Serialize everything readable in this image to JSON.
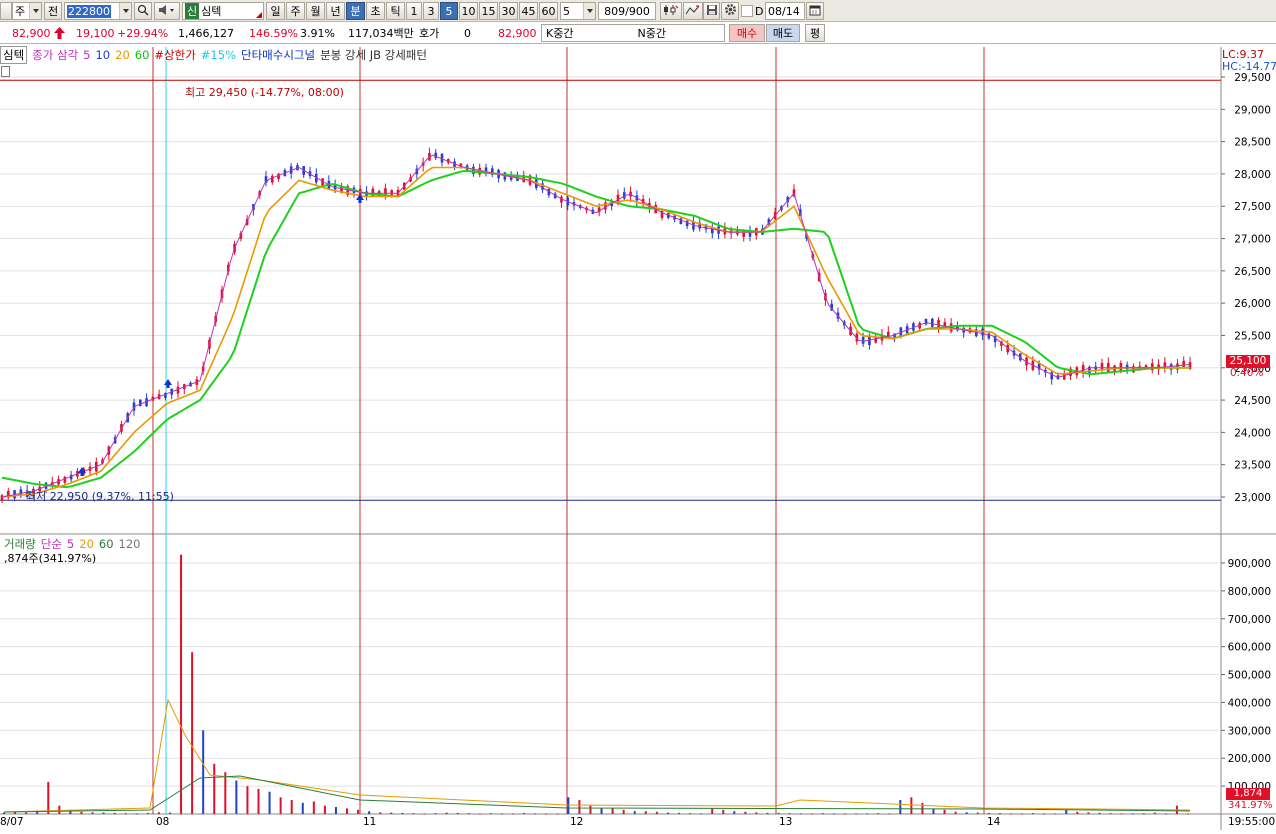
{
  "toolbar": {
    "mode_label": "주",
    "prev_label": "전",
    "code_value": "222800",
    "search_icon": "search-icon",
    "speaker_icon": "speaker-icon",
    "market_badge": "신",
    "stock_name": "심텍",
    "period_tabs": [
      "일",
      "주",
      "월",
      "년",
      "분",
      "초",
      "틱"
    ],
    "active_period": "분",
    "interval_tabs": [
      "1",
      "3",
      "5",
      "10",
      "15",
      "30",
      "45",
      "60"
    ],
    "active_interval": "5",
    "interval_select": "5",
    "count_value": "809",
    "count_total": "/900",
    "tool_icons": [
      "candle-settings-icon",
      "indicator-icon",
      "save-icon",
      "gear-icon"
    ],
    "d_checkbox_label": "D",
    "date_value": "08/14",
    "calendar_icon": "calendar-icon"
  },
  "quote": {
    "price": "82,900",
    "change": "19,100",
    "change_pct": "+29.94%",
    "volume": "1,466,127",
    "volume_ratio": "146.59%",
    "turnover_pct": "3.91%",
    "amount": "117,034백만",
    "bid_label": "호가",
    "bid_value": "0",
    "ask_value": "82,900",
    "k_label": "K중간",
    "n_label": "N중간",
    "buy_label": "매수",
    "sell_label": "매도",
    "flat_label": "평"
  },
  "legend_price": {
    "stock": "심텍",
    "ma_label": "종가 삼각",
    "ma5": "5",
    "ma10": "10",
    "ma20": "20",
    "ma60": "60",
    "upper_limit": "#상한가",
    "pct15": "#15%",
    "signal": "단타매수시그널",
    "pattern": "분봉 강세 JB 강세패턴"
  },
  "legend_volume": {
    "name": "거래량",
    "ma_label": "단순",
    "ma5": "5",
    "ma20": "20",
    "ma60": "60",
    "ma120": "120",
    "current": ",874주(341.97%)"
  },
  "annotations": {
    "high": "최고 29,450 (-14.77%, 08:00)",
    "low": "최저 22,950 (9.37%, 11:55)"
  },
  "right_panel": {
    "lc": "LC:9.37",
    "hc": "HC:-14.77",
    "price_tag": "25,100",
    "price_pct": "0.40%",
    "vol_tag": "1,874",
    "vol_pct": "341.97%",
    "time_label": "19:55:00"
  },
  "chart_data": [
    {
      "type": "line",
      "title": "",
      "x_ticks": [
        "8/07",
        "08",
        "11",
        "12",
        "13",
        "14"
      ],
      "y_ticks": [
        29500,
        29000,
        28500,
        28000,
        27500,
        27000,
        26500,
        26000,
        25500,
        25000,
        24500,
        24000,
        23500,
        23000
      ],
      "ylim": [
        22800,
        29700
      ],
      "high_line": 29450,
      "low_line": 22950,
      "last_price": 25100,
      "series": [
        {
          "name": "5",
          "values": [
            23000,
            23100,
            23300,
            23500,
            24400,
            24600,
            24800,
            26800,
            27900,
            28100,
            27800,
            27700,
            27700,
            28300,
            28100,
            28000,
            27900,
            27600,
            27400,
            27700,
            27400,
            27200,
            27100,
            27100,
            27700,
            26000,
            25400,
            25500,
            25700,
            25600,
            25500,
            25100,
            24850,
            25000,
            25000,
            25000,
            25050
          ]
        },
        {
          "name": "20",
          "values": [
            23000,
            23050,
            23200,
            23400,
            24000,
            24450,
            24650,
            25800,
            27400,
            27900,
            27750,
            27650,
            27650,
            28100,
            28100,
            28000,
            27900,
            27700,
            27500,
            27600,
            27450,
            27250,
            27100,
            27100,
            27500,
            26400,
            25500,
            25450,
            25600,
            25600,
            25550,
            25200,
            24900,
            24950,
            25000,
            25000,
            25000
          ]
        },
        {
          "name": "60",
          "values": [
            23300,
            23200,
            23150,
            23300,
            23700,
            24200,
            24500,
            25200,
            26800,
            27700,
            27850,
            27700,
            27650,
            27900,
            28050,
            28000,
            27950,
            27850,
            27650,
            27500,
            27450,
            27350,
            27150,
            27100,
            27150,
            27100,
            25600,
            25450,
            25600,
            25650,
            25650,
            25400,
            25000,
            24900,
            24950,
            25000,
            25000
          ]
        }
      ]
    },
    {
      "type": "bar",
      "title": "",
      "y_ticks": [
        900000,
        800000,
        700000,
        600000,
        500000,
        400000,
        300000,
        200000,
        100000
      ],
      "ylim": [
        0,
        980000
      ],
      "last_value": 1874,
      "values": [
        5000,
        8000,
        6000,
        12000,
        115000,
        30000,
        15000,
        8000,
        6000,
        5000,
        4000,
        3000,
        2000,
        4000,
        6000,
        5000,
        930000,
        580000,
        300000,
        180000,
        150000,
        120000,
        100000,
        90000,
        80000,
        60000,
        50000,
        40000,
        45000,
        30000,
        25000,
        20000,
        15000,
        10000,
        6000,
        5000,
        4000,
        3000,
        2000,
        3000,
        5000,
        4000,
        3000,
        2000,
        3000,
        2000,
        2000,
        4000,
        2000,
        2000,
        2000,
        60000,
        50000,
        30000,
        20000,
        20000,
        15000,
        10000,
        10000,
        8000,
        5000,
        4000,
        3000,
        2000,
        20000,
        15000,
        10000,
        8000,
        6000,
        4000,
        4000,
        3000,
        2000,
        2000,
        3000,
        2000,
        2000,
        2000,
        2000,
        3000,
        2000,
        50000,
        60000,
        40000,
        20000,
        15000,
        8000,
        6000,
        5000,
        4000,
        3000,
        2000,
        2000,
        3000,
        2000,
        2000,
        15000,
        8000,
        6000,
        4000,
        3000,
        2000,
        2000,
        3000,
        5000,
        2000,
        30000,
        2000
      ]
    }
  ]
}
